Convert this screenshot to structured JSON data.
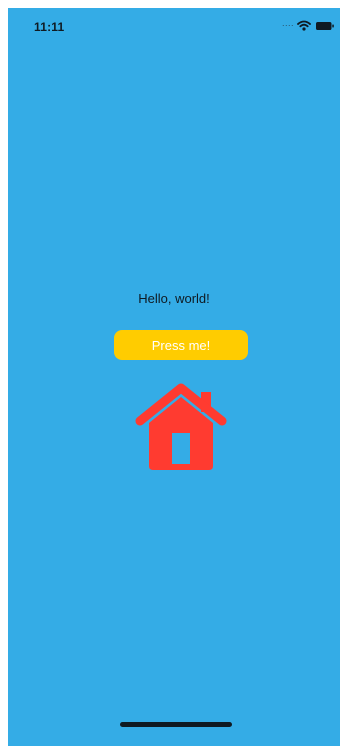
{
  "status_bar": {
    "time": "11:11",
    "signal_text": "....",
    "icons": [
      "wifi-icon",
      "battery-icon"
    ]
  },
  "content": {
    "greeting": "Hello, world!",
    "button_label": "Press me!",
    "image_icon": "house-icon"
  },
  "colors": {
    "background": "#34ace6",
    "button": "#ffcc00",
    "button_text": "#ffffff",
    "house": "#ff3b30",
    "text": "#0f1a22"
  }
}
